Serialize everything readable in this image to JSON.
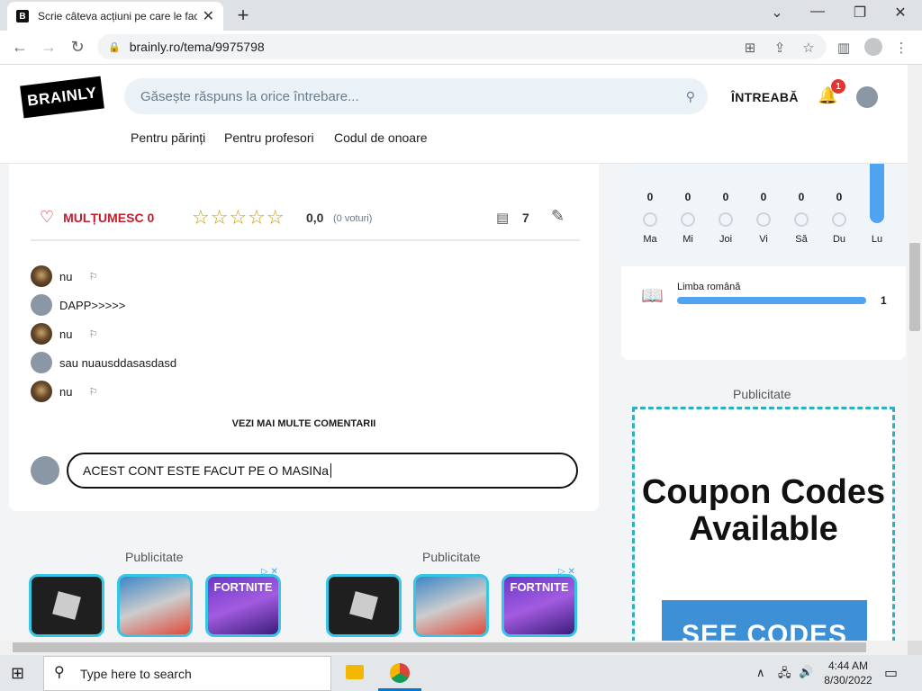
{
  "browser": {
    "tab_title": "Scrie câteva acțiuni pe care le fac",
    "url": "brainly.ro/tema/9975798",
    "window_controls": {
      "minimize": "—",
      "restore": "❐",
      "close": "✕"
    },
    "chevron": "⌄"
  },
  "site": {
    "logo": "BRAINLY",
    "search_placeholder": "Găsește răspuns la orice întrebare...",
    "ask_label": "ÎNTREABĂ",
    "notif_count": "1",
    "nav": [
      "Pentru părinți",
      "Pentru profesori",
      "Codul de onoare"
    ]
  },
  "answer": {
    "thanks_label": "MULȚUMESC 0",
    "stars": "☆☆☆☆☆",
    "rating": "0,0",
    "votes": "(0 voturi)",
    "comment_count": "7",
    "comments": [
      {
        "text": "nu",
        "avatar": "image",
        "flag": true
      },
      {
        "text": "DAPP>>>>>",
        "avatar": "default",
        "flag": false
      },
      {
        "text": "nu",
        "avatar": "image",
        "flag": true
      },
      {
        "text": "sau nuausddasasdasd",
        "avatar": "default",
        "flag": false
      },
      {
        "text": "nu",
        "avatar": "image",
        "flag": true
      }
    ],
    "more_comments_label": "VEZI MAI MULTE COMENTARII",
    "reply_value": "ACEST CONT ESTE FACUT PE O MASINa"
  },
  "activity": {
    "days": [
      {
        "label": "Ma",
        "value": "0"
      },
      {
        "label": "Mi",
        "value": "0"
      },
      {
        "label": "Joi",
        "value": "0"
      },
      {
        "label": "Vi",
        "value": "0"
      },
      {
        "label": "Să",
        "value": "0"
      },
      {
        "label": "Du",
        "value": "0"
      },
      {
        "label": "Lu",
        "value": ""
      }
    ],
    "subject": "Limba română",
    "subject_count": "1",
    "subject_fill": 1.0
  },
  "ads": {
    "label": "Publicitate",
    "tile_fortnite_text": "FORTNITE",
    "coupon_title": "Coupon Codes Available",
    "coupon_button": "SEE CODES",
    "ad_close": "▷ ✕"
  },
  "taskbar": {
    "search_placeholder": "Type here to search",
    "time": "4:44 AM",
    "date": "8/30/2022"
  },
  "colors": {
    "accent_red": "#c51d2e",
    "accent_blue": "#4fa3f0",
    "star": "#c9a000"
  }
}
